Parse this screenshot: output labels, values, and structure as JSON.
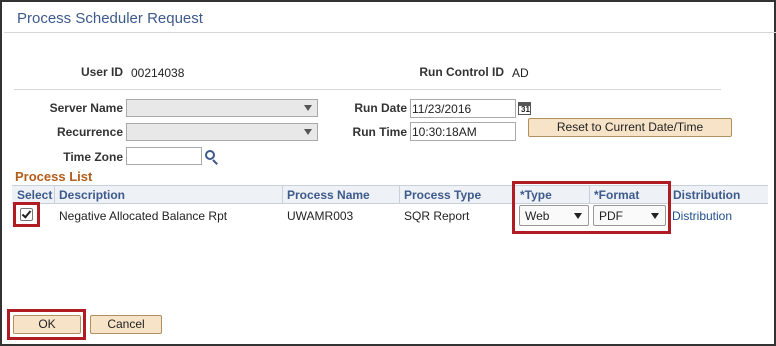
{
  "window": {
    "title": "Process Scheduler Request"
  },
  "user": {
    "label": "User ID",
    "value": "00214038"
  },
  "run_control": {
    "label": "Run Control ID",
    "value": "AD"
  },
  "server_name": {
    "label": "Server Name",
    "value": ""
  },
  "recurrence": {
    "label": "Recurrence",
    "value": ""
  },
  "time_zone": {
    "label": "Time Zone",
    "value": ""
  },
  "run_date": {
    "label": "Run Date",
    "value": "11/23/2016",
    "cal_glyph": "31"
  },
  "run_time": {
    "label": "Run Time",
    "value": "10:30:18AM"
  },
  "reset_button": {
    "label": "Reset to Current Date/Time"
  },
  "process_list": {
    "title": "Process List",
    "headers": {
      "select": "Select",
      "description": "Description",
      "process_name": "Process Name",
      "process_type": "Process Type",
      "type": "*Type",
      "format": "*Format",
      "distribution": "Distribution"
    },
    "rows": [
      {
        "selected": true,
        "description": "Negative Allocated Balance Rpt",
        "process_name": "UWAMR003",
        "process_type": "SQR Report",
        "type": "Web",
        "format": "PDF",
        "distribution": "Distribution"
      }
    ]
  },
  "footer": {
    "ok_label": "OK",
    "cancel_label": "Cancel"
  },
  "colors": {
    "title": "#3d5a8c",
    "section": "#b35d1a",
    "button_bg": "#f6e3c8",
    "highlight": "#b01c24",
    "link": "#1f4e8c"
  },
  "icons": {
    "lookup": "search-icon",
    "calendar": "calendar-icon",
    "dropdown": "chevron-down-icon",
    "checkbox": "checkmark-icon"
  }
}
